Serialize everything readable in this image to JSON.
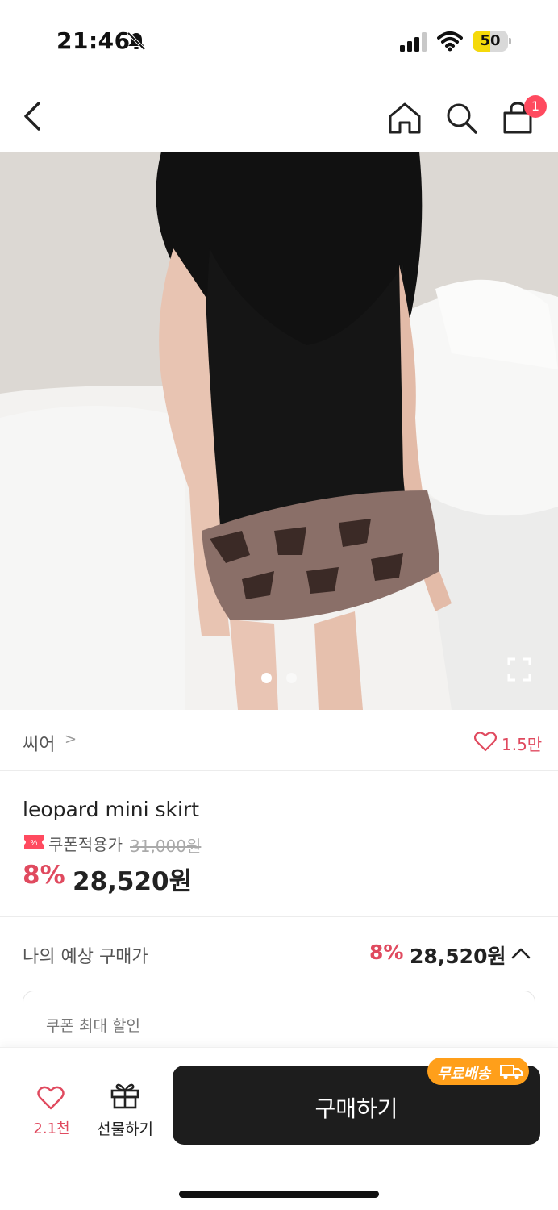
{
  "status_bar": {
    "time": "21:46",
    "battery_level": "50",
    "battery_fraction": 0.5,
    "icons": [
      "bell-off-icon",
      "signal-icon",
      "wifi-icon",
      "battery-icon"
    ]
  },
  "nav": {
    "cart_count": "1",
    "icons": [
      "back-icon",
      "home-icon",
      "search-icon",
      "cart-icon"
    ]
  },
  "gallery": {
    "current_page": 1,
    "total_pages": 2
  },
  "brand": {
    "name": "씨어",
    "chevron": ">",
    "like_count": "1.5만"
  },
  "product": {
    "title": "leopard mini skirt",
    "coupon_label": "쿠폰적용가",
    "original_price": "31,000원",
    "discount_rate": "8%",
    "sale_price": "28,520원"
  },
  "expected": {
    "label": "나의 예상 구매가",
    "discount_rate": "8%",
    "price": "28,520원"
  },
  "coupon_box": {
    "label": "쿠폰 최대 할인"
  },
  "bottom_bar": {
    "wish_count": "2.1천",
    "gift_label": "선물하기",
    "buy_label": "구매하기",
    "free_shipping_label": "무료배송"
  },
  "colors": {
    "accent": "#e04a5f",
    "badge": "#ff4a5f",
    "shipping_badge": "#ff9f1a",
    "buy_button": "#1d1d1d"
  }
}
